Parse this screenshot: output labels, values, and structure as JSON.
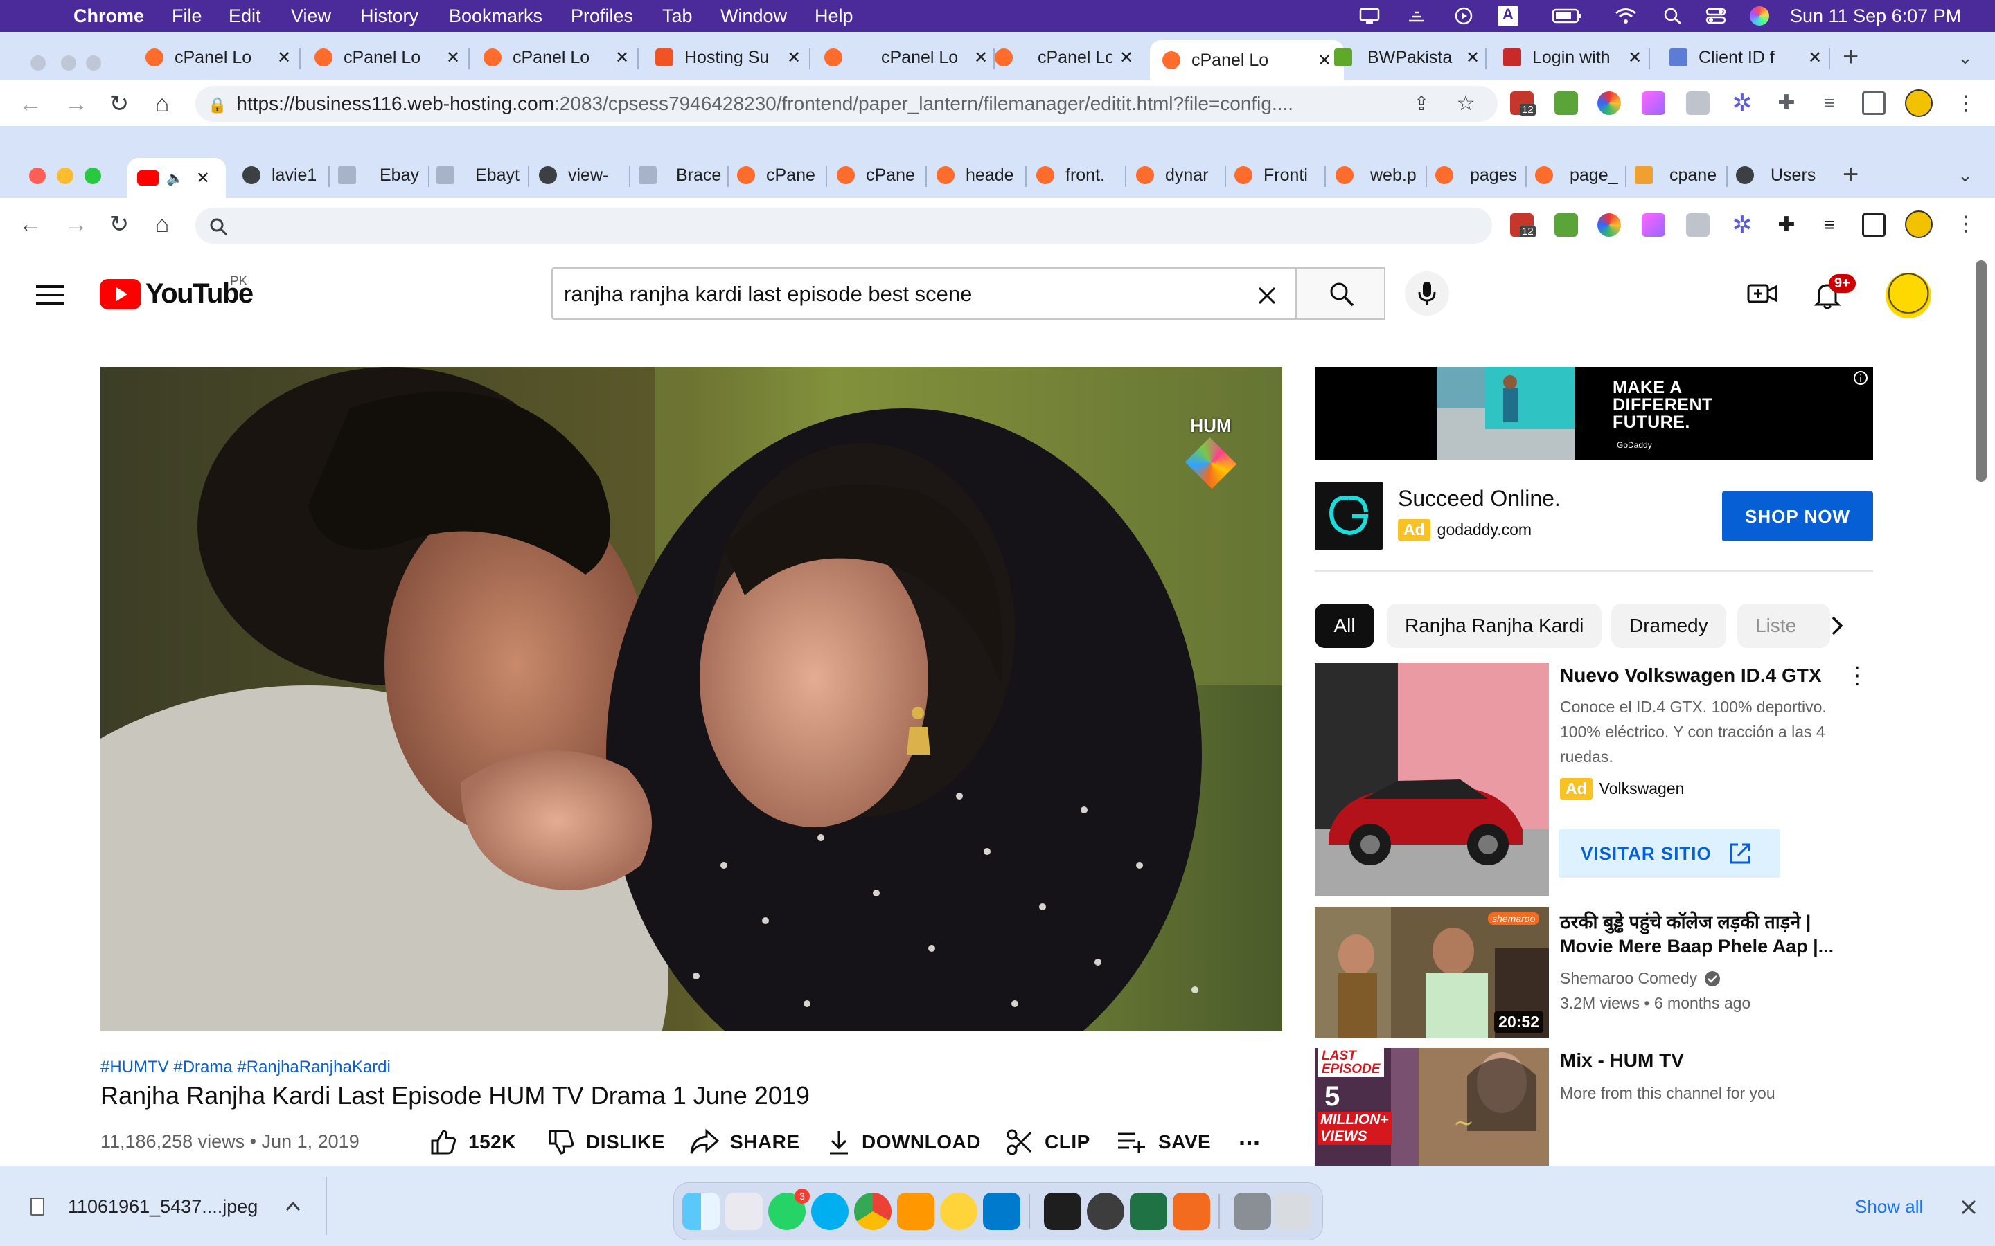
{
  "menubar": {
    "app": "Chrome",
    "items": [
      "File",
      "Edit",
      "View",
      "History",
      "Bookmarks",
      "Profiles",
      "Tab",
      "Window",
      "Help"
    ],
    "datetime": "Sun 11 Sep  6:07 PM"
  },
  "window1": {
    "tabs": [
      {
        "title": "cPanel Lo"
      },
      {
        "title": "cPanel Lo"
      },
      {
        "title": "cPanel Lo"
      },
      {
        "title": "Hosting Su"
      },
      {
        "title": "cPanel Lo"
      },
      {
        "title": "cPanel Lo"
      },
      {
        "title": "cPanel Lo"
      },
      {
        "title": "BWPakista"
      },
      {
        "title": "Login with"
      },
      {
        "title": "Client ID f"
      }
    ],
    "url_domain": "https://business116.web-hosting.com",
    "url_path": ":2083/cpsess7946428230/frontend/paper_lantern/filemanager/editit.html?file=config....",
    "ext_badge": "12"
  },
  "window2": {
    "tabs": [
      {
        "title": ""
      },
      {
        "title": "lavie1"
      },
      {
        "title": "Ebay"
      },
      {
        "title": "Ebayt"
      },
      {
        "title": "view-"
      },
      {
        "title": "Brace"
      },
      {
        "title": "cPane"
      },
      {
        "title": "cPane"
      },
      {
        "title": "heade"
      },
      {
        "title": "front."
      },
      {
        "title": "dynar"
      },
      {
        "title": "Fronti"
      },
      {
        "title": "web.p"
      },
      {
        "title": "pages"
      },
      {
        "title": "page_"
      },
      {
        "title": "cpane"
      },
      {
        "title": "Users"
      }
    ],
    "ext_badge": "12"
  },
  "youtube": {
    "logo_text": "YouTube",
    "region": "PK",
    "search_query": "ranjha ranjha kardi last episode best scene",
    "notif_count": "9+",
    "video": {
      "channel_logo": "HUM",
      "hashtags": "#HUMTV #Drama #RanjhaRanjhaKardi",
      "title": "Ranjha Ranjha Kardi Last Episode HUM TV Drama 1 June 2019",
      "views_date": "11,186,258 views • Jun 1, 2019",
      "likes": "152K",
      "dislike": "DISLIKE",
      "share": "SHARE",
      "download": "DOWNLOAD",
      "clip": "CLIP",
      "save": "SAVE",
      "more": "..."
    },
    "banner_ad": {
      "headline": "MAKE A DIFFERENT FUTURE.",
      "brand": "GoDaddy"
    },
    "promo": {
      "title": "Succeed Online.",
      "badge": "Ad",
      "domain": "godaddy.com",
      "button": "SHOP NOW"
    },
    "chips": [
      "All",
      "Ranjha Ranjha Kardi",
      "Dramedy",
      "Liste"
    ],
    "vw_ad": {
      "title": "Nuevo Volkswagen ID.4 GTX",
      "desc1": "Conoce el ID.4 GTX. 100% deportivo.",
      "desc2": "100% eléctrico. Y con tracción a las 4",
      "desc3": "ruedas.",
      "badge": "Ad",
      "advertiser": "Volkswagen",
      "button": "VISITAR SITIO"
    },
    "rec1": {
      "title1": "ठरकी बुड्ढे पहुंचे कॉलेज लड़की ताड़ने |",
      "title2": "Movie Mere Baap Phele Aap |...",
      "channel": "Shemaroo Comedy",
      "meta": "3.2M views • 6 months ago",
      "duration": "20:52",
      "thumb_brand": "shemaroo"
    },
    "rec2": {
      "title": "Mix - HUM TV",
      "sub": "More from this channel for you",
      "thumb_line1": "LAST",
      "thumb_line2": "EPISODE",
      "thumb_num": "5",
      "thumb_line3": "MILLION+",
      "thumb_line4": "VIEWS"
    }
  },
  "downloads": {
    "file": "11061961_5437....jpeg",
    "show_all": "Show all"
  },
  "dock": {
    "whatsapp_badge": "3"
  },
  "colors": {
    "menubar": "#4b2a9a",
    "chrome_frame": "#d6e3f8",
    "yt_red": "#ff0000",
    "link_blue": "#065fd4",
    "ad_yellow": "#f9c224"
  }
}
